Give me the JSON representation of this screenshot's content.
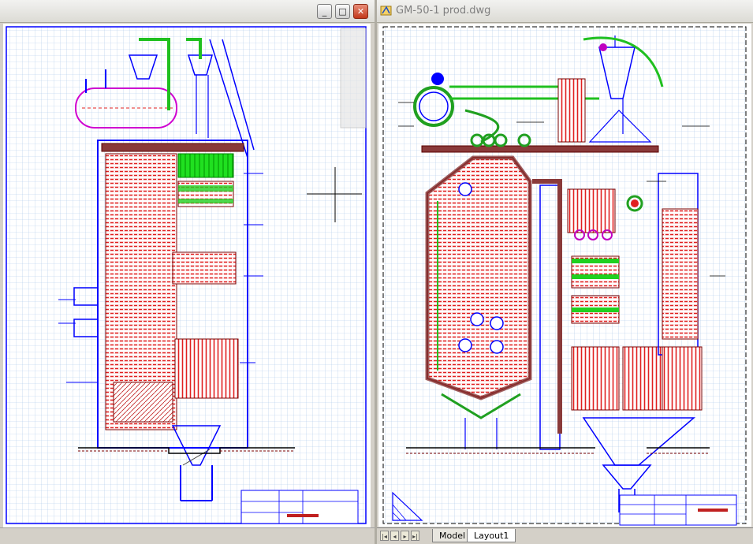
{
  "left_window": {
    "controls": {
      "minimize": "_",
      "maximize": "□",
      "close": "✕"
    }
  },
  "right_window": {
    "title": "GM-50-1 prod.dwg",
    "tabs": [
      {
        "label": "Model",
        "active": false
      },
      {
        "label": "Layout1",
        "active": true
      }
    ]
  },
  "colors": {
    "grid": "#9fc0e6",
    "border": "#0000ff",
    "pipes": "#00c000",
    "tubes": "#e02020",
    "outline": "#7a0000",
    "magenta": "#c000c0"
  },
  "icons": [
    "autocad-file-icon",
    "crosshair-cursor-icon",
    "viewcube-icon",
    "ucs-icon"
  ]
}
